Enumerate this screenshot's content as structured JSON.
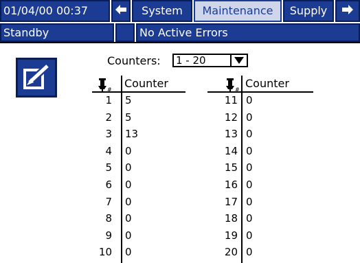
{
  "header": {
    "datetime": "01/04/00 00:37",
    "back_icon": "left-arrow-icon",
    "forward_icon": "right-arrow-icon",
    "tabs": [
      {
        "label": "System",
        "active": false
      },
      {
        "label": "Maintenance",
        "active": true
      },
      {
        "label": "Supply",
        "active": false
      }
    ]
  },
  "status": {
    "mode": "Standby",
    "errors": "No Active Errors"
  },
  "controls": {
    "edit_icon": "edit-icon",
    "counters_label": "Counters:",
    "counters_value": "1 - 20"
  },
  "table": {
    "column_icon": "dispense-valve-icon",
    "column_label": "Counter",
    "left": [
      {
        "num": "1",
        "value": "5"
      },
      {
        "num": "2",
        "value": "5"
      },
      {
        "num": "3",
        "value": "13"
      },
      {
        "num": "4",
        "value": "0"
      },
      {
        "num": "5",
        "value": "0"
      },
      {
        "num": "6",
        "value": "0"
      },
      {
        "num": "7",
        "value": "0"
      },
      {
        "num": "8",
        "value": "0"
      },
      {
        "num": "9",
        "value": "0"
      },
      {
        "num": "10",
        "value": "0"
      }
    ],
    "right": [
      {
        "num": "11",
        "value": "0"
      },
      {
        "num": "12",
        "value": "0"
      },
      {
        "num": "13",
        "value": "0"
      },
      {
        "num": "14",
        "value": "0"
      },
      {
        "num": "15",
        "value": "0"
      },
      {
        "num": "16",
        "value": "0"
      },
      {
        "num": "17",
        "value": "0"
      },
      {
        "num": "18",
        "value": "0"
      },
      {
        "num": "19",
        "value": "0"
      },
      {
        "num": "20",
        "value": "0"
      }
    ]
  },
  "colors": {
    "accent": "#1c3c93",
    "tab_inactive_bg": "#cfd6e9"
  }
}
